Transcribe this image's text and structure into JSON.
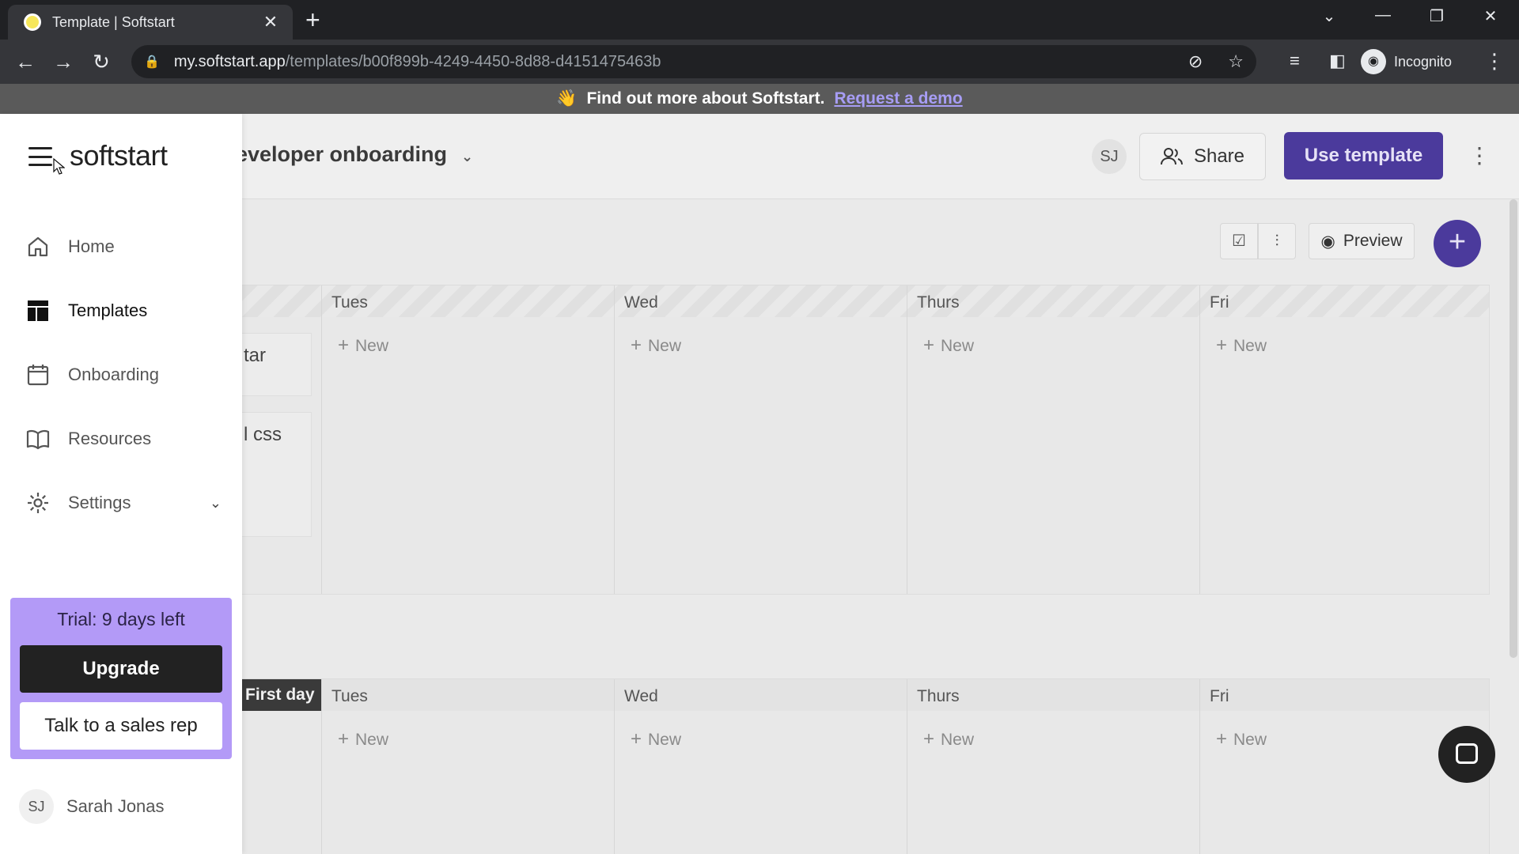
{
  "browser": {
    "tab_title": "Template | Softstart",
    "url_host": "my.softstart.app",
    "url_path": "/templates/b00f899b-4249-4450-8d88-d4151475463b",
    "profile_label": "Incognito"
  },
  "banner": {
    "emoji": "👋",
    "text": "Find out more about Softstart.",
    "link": "Request a demo"
  },
  "header": {
    "doc_title": "eveloper onboarding",
    "avatar": "SJ",
    "share_label": "Share",
    "use_template_label": "Use template",
    "preview_label": "Preview"
  },
  "week1": {
    "days": [
      "Tues",
      "Wed",
      "Thurs",
      "Fri"
    ],
    "new_label": "New",
    "cards": [
      "tar",
      "l css"
    ]
  },
  "week2": {
    "first_day_label": "First day",
    "days": [
      "Tues",
      "Wed",
      "Thurs",
      "Fri"
    ],
    "new_label": "New"
  },
  "sidebar": {
    "logo": "softstart",
    "items": [
      {
        "label": "Home",
        "icon": "home-icon"
      },
      {
        "label": "Templates",
        "icon": "templates-icon"
      },
      {
        "label": "Onboarding",
        "icon": "calendar-icon"
      },
      {
        "label": "Resources",
        "icon": "book-icon"
      },
      {
        "label": "Settings",
        "icon": "gear-icon"
      }
    ],
    "trial_text": "Trial: 9 days left",
    "upgrade_label": "Upgrade",
    "sales_label": "Talk to a sales rep",
    "user_initials": "SJ",
    "user_name": "Sarah Jonas"
  },
  "colors": {
    "brand_purple": "#4b3a9c",
    "trial_purple": "#b39af7",
    "link_purple": "#a79df5"
  }
}
